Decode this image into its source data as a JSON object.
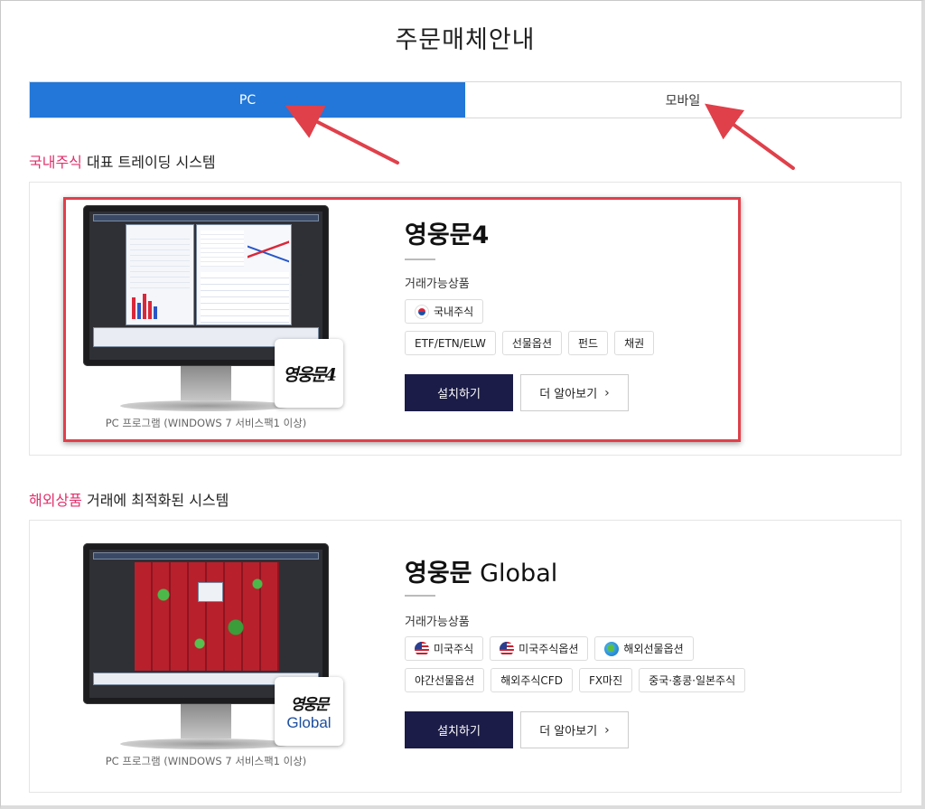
{
  "page": {
    "title": "주문매체안내"
  },
  "tabs": [
    {
      "label": "PC",
      "active": true
    },
    {
      "label": "모바일",
      "active": false
    }
  ],
  "sections": [
    {
      "accent": "국내주식",
      "title_rest": " 대표 트레이딩 시스템",
      "product": {
        "name": "영웅문4",
        "logo_text": "영웅문4",
        "tradable_label": "거래가능상품",
        "chips_row1": [
          {
            "label": "국내주식",
            "icon": "korea-flag-icon"
          }
        ],
        "chips_row2": [
          {
            "label": "ETF/ETN/ELW"
          },
          {
            "label": "선물옵션"
          },
          {
            "label": "펀드"
          },
          {
            "label": "채권"
          }
        ],
        "install_label": "설치하기",
        "more_label": "더 알아보기",
        "caption": "PC 프로그램 (WINDOWS 7 서비스팩1 이상)"
      }
    },
    {
      "accent": "해외상품",
      "title_rest": " 거래에 최적화된 시스템",
      "product": {
        "name_main": "영웅문",
        "name_sub": " Global",
        "logo_text_top": "영웅문",
        "logo_text_bottom": "Global",
        "tradable_label": "거래가능상품",
        "chips_row1": [
          {
            "label": "미국주식",
            "icon": "us-flag-icon"
          },
          {
            "label": "미국주식옵션",
            "icon": "us-flag-icon"
          },
          {
            "label": "해외선물옵션",
            "icon": "globe-icon"
          }
        ],
        "chips_row2": [
          {
            "label": "야간선물옵션"
          },
          {
            "label": "해외주식CFD"
          },
          {
            "label": "FX마진"
          },
          {
            "label": "중국·홍콩·일본주식"
          }
        ],
        "install_label": "설치하기",
        "more_label": "더 알아보기",
        "caption": "PC 프로그램 (WINDOWS 7 서비스팩1 이상)"
      }
    }
  ],
  "colors": {
    "tab_active": "#2277d8",
    "accent": "#e0316c",
    "primary_button": "#1b1c47",
    "annotation": "#e0404a"
  }
}
